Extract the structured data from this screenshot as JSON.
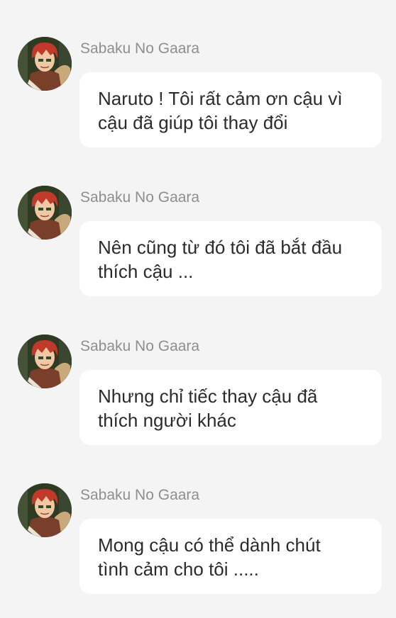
{
  "messages": [
    {
      "sender": "Sabaku No Gaara",
      "avatar_icon": "gaara-avatar-icon",
      "text": "Naruto ! Tôi rất cảm ơn cậu vì\ncậu đã giúp tôi thay đổi"
    },
    {
      "sender": "Sabaku No Gaara",
      "avatar_icon": "gaara-avatar-icon",
      "text": "Nên cũng từ đó tôi đã bắt đầu\nthích cậu ..."
    },
    {
      "sender": "Sabaku No Gaara",
      "avatar_icon": "gaara-avatar-icon",
      "text": "Nhưng chỉ tiếc thay cậu đã\nthích người khác"
    },
    {
      "sender": "Sabaku No Gaara",
      "avatar_icon": "gaara-avatar-icon",
      "text": "Mong cậu có thể dành chút\ntình cảm cho tôi ....."
    }
  ],
  "colors": {
    "background": "#f4f4f4",
    "bubble": "#ffffff",
    "sender_text": "#8e8e8e",
    "message_text": "#2b2b2b",
    "hair": "#c0392b"
  }
}
